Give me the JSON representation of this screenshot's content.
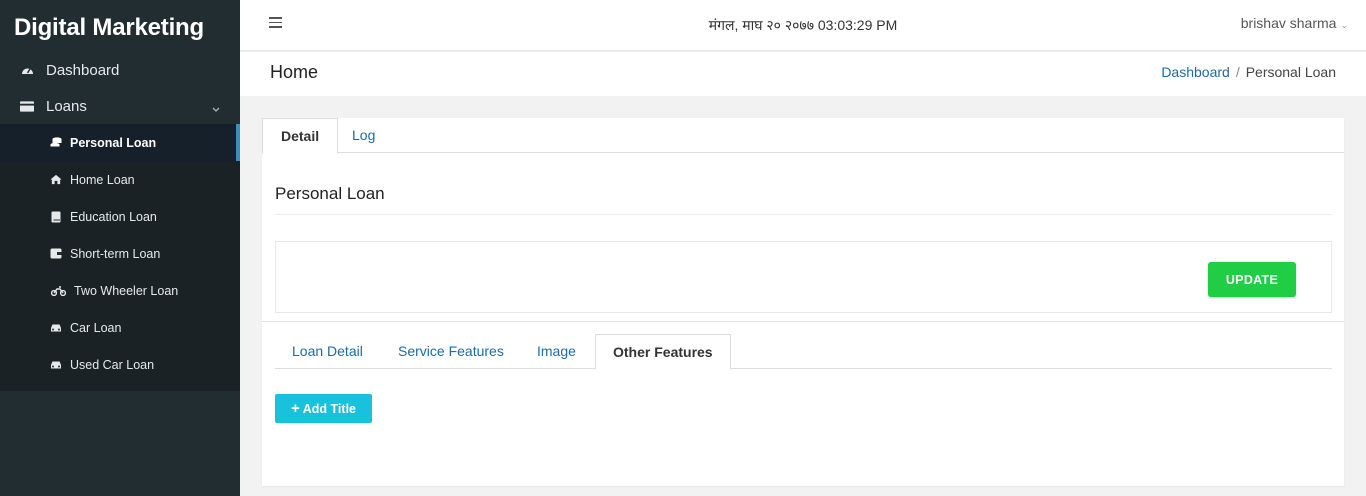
{
  "sidebar": {
    "brand": "Digital Marketing",
    "dashboard_label": "Dashboard",
    "loans_label": "Loans",
    "loan_items": [
      {
        "label": "Personal Loan",
        "icon": "coins-icon",
        "active": true
      },
      {
        "label": "Home Loan",
        "icon": "home-icon"
      },
      {
        "label": "Education Loan",
        "icon": "book-icon"
      },
      {
        "label": "Short-term Loan",
        "icon": "wallet-icon"
      },
      {
        "label": "Two Wheeler Loan",
        "icon": "motorcycle-icon"
      },
      {
        "label": "Car Loan",
        "icon": "car-icon"
      },
      {
        "label": "Used Car Loan",
        "icon": "car-icon"
      }
    ]
  },
  "header": {
    "datetime": "मंगल, माघ २० २०७७ 03:03:29 PM",
    "user": "brishav sharma"
  },
  "page": {
    "title": "Home",
    "breadcrumb": {
      "home": "Dashboard",
      "separator": "/",
      "current": "Personal Loan"
    }
  },
  "card": {
    "tabs": [
      "Detail",
      "Log"
    ],
    "section_title": "Personal Loan",
    "update_label": "UPDATE",
    "inner_tabs": [
      "Loan Detail",
      "Service Features",
      "Image",
      "Other Features"
    ],
    "add_title_label": "Add Title"
  },
  "colors": {
    "sidebar_bg": "#222d32",
    "accent_blue": "#3c8dbc",
    "update_green": "#1fce45",
    "add_cyan": "#18c2dc",
    "link": "#1e6aa8"
  }
}
